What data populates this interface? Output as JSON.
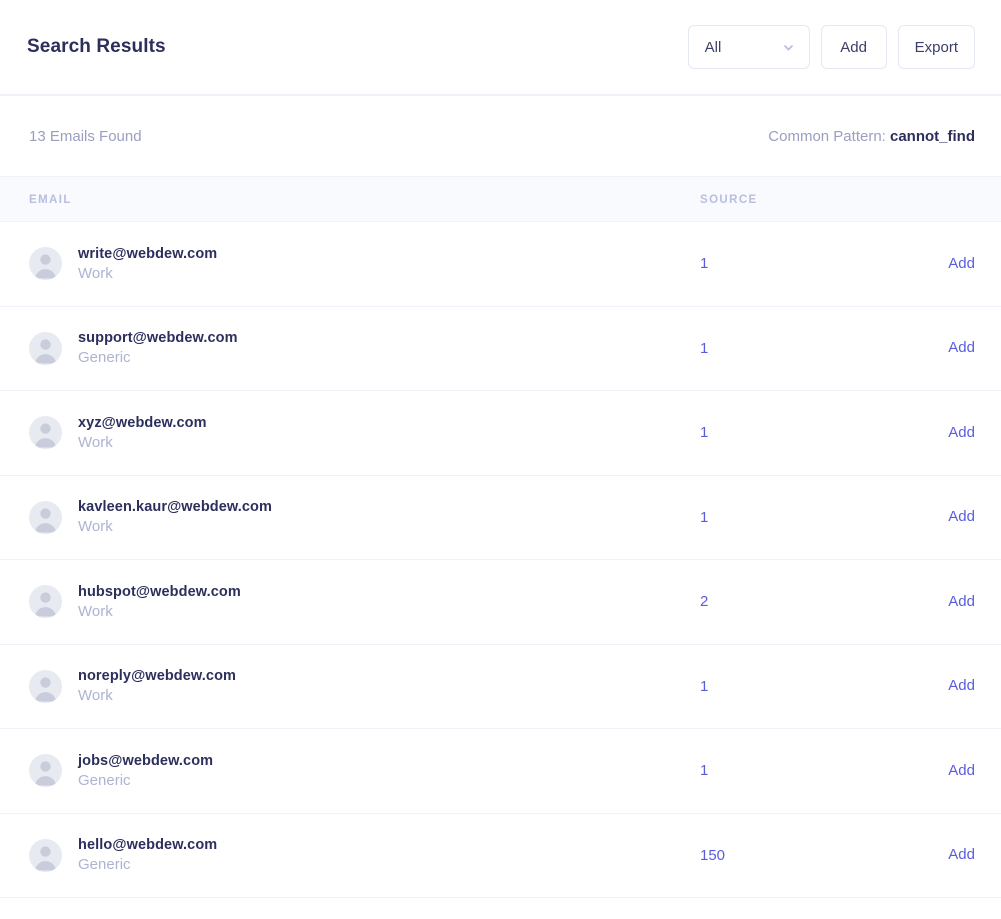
{
  "header": {
    "title": "Search Results",
    "filter": {
      "selected": "All",
      "icon": "chevron-down-icon"
    },
    "add_label": "Add",
    "export_label": "Export"
  },
  "summary": {
    "count_text": "13 Emails Found",
    "pattern_label": "Common Pattern:",
    "pattern_value": "cannot_find"
  },
  "table": {
    "columns": {
      "email": "EMAIL",
      "source": "SOURCE"
    },
    "action_label": "Add",
    "rows": [
      {
        "email": "write@webdew.com",
        "type": "Work",
        "source": "1",
        "action": "Add"
      },
      {
        "email": "support@webdew.com",
        "type": "Generic",
        "source": "1",
        "action": "Add"
      },
      {
        "email": "xyz@webdew.com",
        "type": "Work",
        "source": "1",
        "action": "Add"
      },
      {
        "email": "kavleen.kaur@webdew.com",
        "type": "Work",
        "source": "1",
        "action": "Add"
      },
      {
        "email": "hubspot@webdew.com",
        "type": "Work",
        "source": "2",
        "action": "Add"
      },
      {
        "email": "noreply@webdew.com",
        "type": "Work",
        "source": "1",
        "action": "Add"
      },
      {
        "email": "jobs@webdew.com",
        "type": "Generic",
        "source": "1",
        "action": "Add"
      },
      {
        "email": "hello@webdew.com",
        "type": "Generic",
        "source": "150",
        "action": "Add"
      }
    ]
  },
  "colors": {
    "accent": "#5a5ce0",
    "title": "#2c2f5c",
    "muted": "#aeb3d1",
    "header_band": "#f9fafd",
    "border": "#f1f3fa"
  }
}
